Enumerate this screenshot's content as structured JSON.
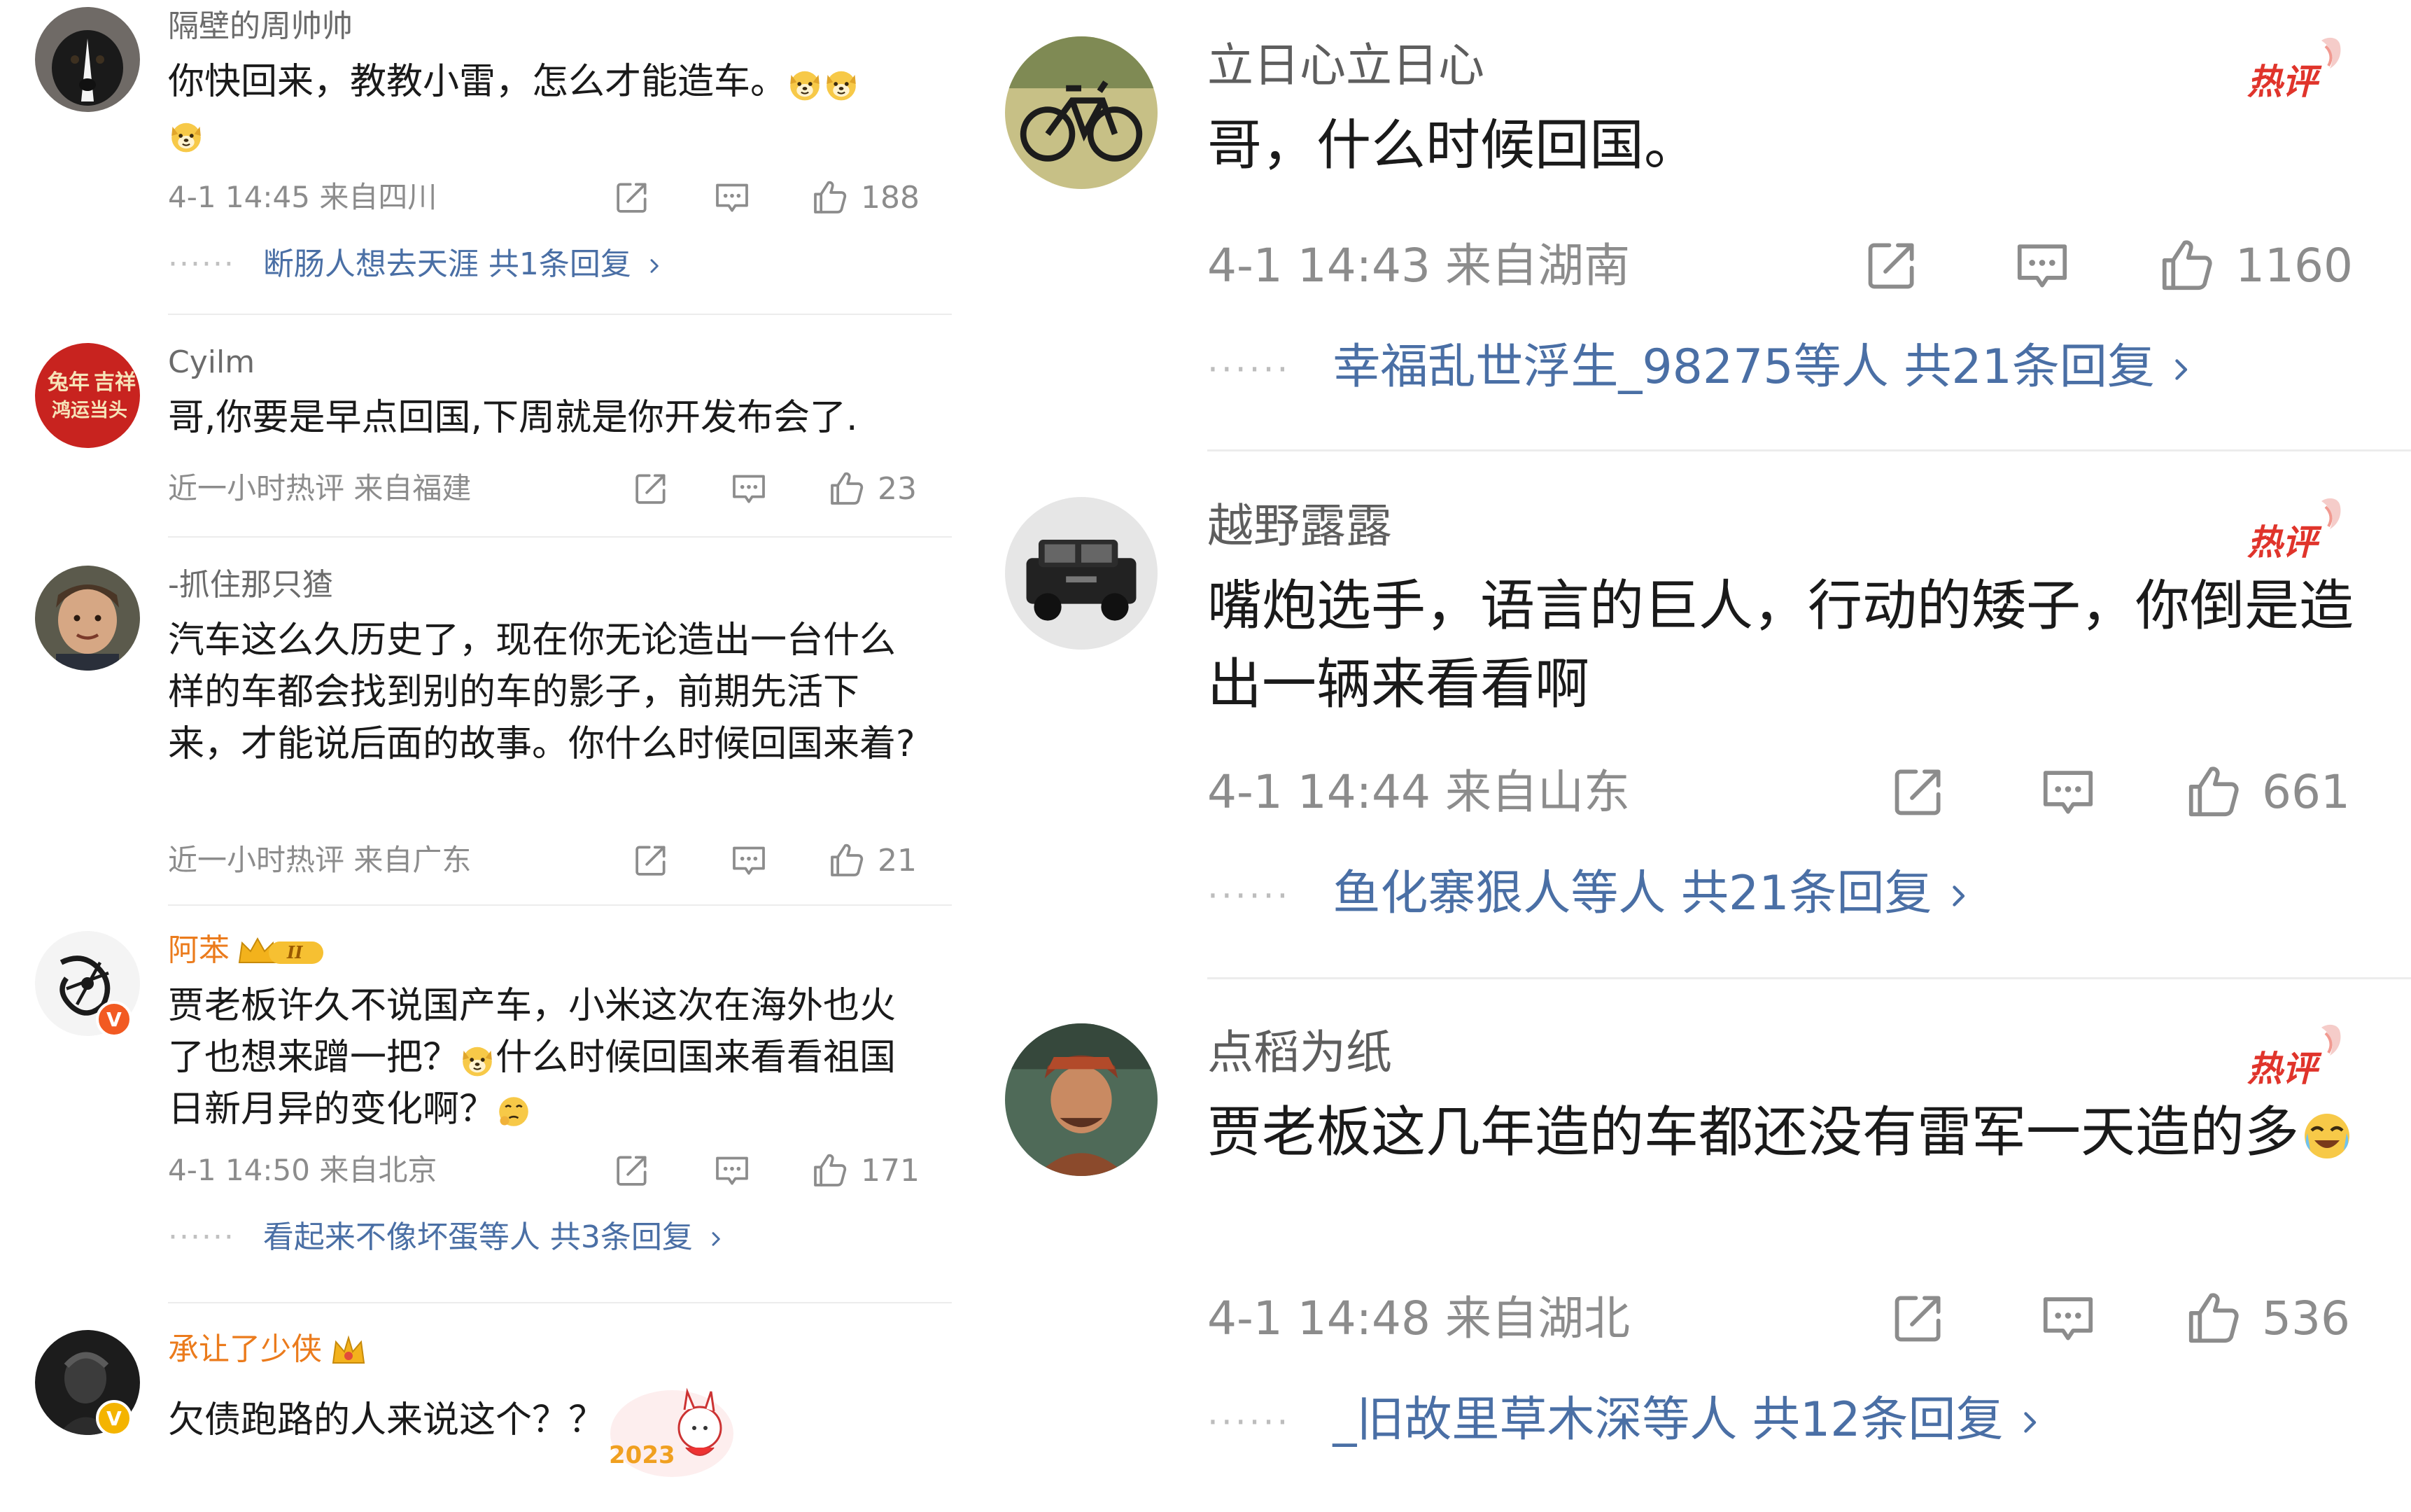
{
  "left": {
    "comments": [
      {
        "username": "隔壁的周帅帅",
        "text": "你快回来，教教小雷，怎么才能造车。",
        "time": "4-1 14:45",
        "location": "来自四川",
        "likes": "188",
        "replies": {
          "names": "断肠人想去天涯",
          "count": "共1条回复"
        }
      },
      {
        "username": "Cyilm",
        "text": "哥,你要是早点回国,下周就是你开发布会了.",
        "time": "近一小时热评",
        "location": "来自福建",
        "likes": "23"
      },
      {
        "username": "-抓住那只猹",
        "text": "汽车这么久历史了，现在你无论造出一台什么样的车都会找到别的车的影子，前期先活下来，才能说后面的故事。你什么时候回国来着?",
        "time": "近一小时热评",
        "location": "来自广东",
        "likes": "21"
      },
      {
        "username": "阿苯",
        "vip_badge": "II",
        "text_a": "贾老板许久不说国产车，小米这次在海外也火了也想来蹭一把？",
        "text_b": "什么时候回国来看看祖国日新月异的变化啊？",
        "time": "4-1 14:50",
        "location": "来自北京",
        "likes": "171",
        "replies": {
          "names": "看起来不像坏蛋等人",
          "count": "共3条回复"
        }
      },
      {
        "username": "承让了少侠",
        "text": "欠债跑路的人来说这个？？",
        "sticker_text": "2023"
      }
    ]
  },
  "right": {
    "hot_label": "热评",
    "comments": [
      {
        "username": "立日心立日心",
        "text": "哥，什么时候回国。",
        "time": "4-1 14:43",
        "location": "来自湖南",
        "likes": "1160",
        "replies": {
          "names": "幸福乱世浮生_98275等人",
          "count": "共21条回复"
        }
      },
      {
        "username": "越野露露",
        "text": "嘴炮选手，语言的巨人，行动的矮子，你倒是造出一辆来看看啊",
        "time": "4-1 14:44",
        "location": "来自山东",
        "likes": "661",
        "replies": {
          "names": "鱼化寨狠人等人",
          "count": "共21条回复"
        }
      },
      {
        "username": "点稻为纸",
        "text": "贾老板这几年造的车都还没有雷军一天造的多",
        "time": "4-1 14:48",
        "location": "来自湖北",
        "likes": "536",
        "replies": {
          "names": "_旧故里草木深等人",
          "count": "共12条回复"
        }
      }
    ]
  },
  "colors": {
    "username_vip": "#eb7b1c",
    "reply_link": "#4a6fa5",
    "hot_red": "#e0342b",
    "meta_gray": "#8c8c8c"
  },
  "icons": [
    "share-icon",
    "comment-icon",
    "like-icon",
    "chevron-right-icon",
    "hot-comment-badge",
    "vip-crown-icon",
    "verified-badge"
  ]
}
